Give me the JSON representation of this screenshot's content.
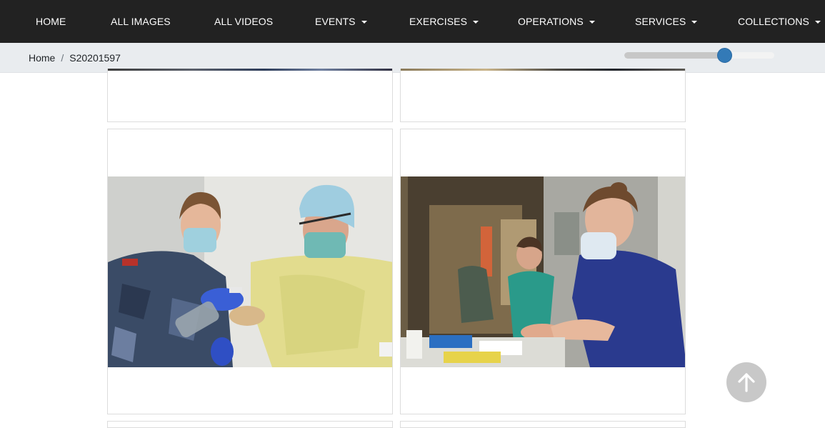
{
  "nav": {
    "items": [
      {
        "label": "HOME",
        "dropdown": false
      },
      {
        "label": "ALL IMAGES",
        "dropdown": false
      },
      {
        "label": "ALL VIDEOS",
        "dropdown": false
      },
      {
        "label": "EVENTS",
        "dropdown": true
      },
      {
        "label": "EXERCISES",
        "dropdown": true
      },
      {
        "label": "OPERATIONS",
        "dropdown": true
      },
      {
        "label": "SERVICES",
        "dropdown": true
      },
      {
        "label": "COLLECTIONS",
        "dropdown": true
      }
    ]
  },
  "breadcrumb": {
    "home": "Home",
    "separator": "/",
    "current": "S20201597"
  },
  "zoom_slider": {
    "level": 0.67,
    "accent": "#337ab7"
  },
  "gallery": {
    "cards": [
      {
        "name": "image-card-top-left",
        "partial": true
      },
      {
        "name": "image-card-top-right",
        "partial": true
      },
      {
        "name": "image-card-hand-sanitiser-raaf",
        "partial": false
      },
      {
        "name": "image-card-nurse-hand-sanitiser",
        "partial": false
      }
    ]
  },
  "scroll_to_top": {
    "icon": "arrow-up-icon"
  },
  "colors": {
    "navbar": "#222222",
    "subbar": "#e9ecef",
    "accent": "#337ab7"
  }
}
